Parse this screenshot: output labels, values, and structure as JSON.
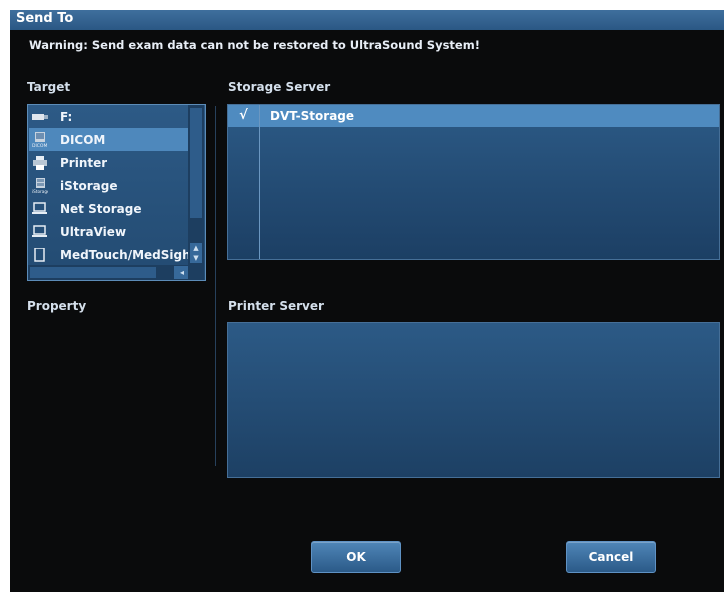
{
  "dialog": {
    "title": "Send To",
    "warning": "Warning: Send exam data can not be restored to UltraSound System!"
  },
  "target": {
    "label": "Target",
    "items": [
      {
        "label": "F:",
        "icon": "usb-drive-icon",
        "selected": false
      },
      {
        "label": "DICOM",
        "icon": "dicom-icon",
        "selected": true
      },
      {
        "label": "Printer",
        "icon": "printer-icon",
        "selected": false
      },
      {
        "label": "iStorage",
        "icon": "istorage-icon",
        "selected": false
      },
      {
        "label": "Net Storage",
        "icon": "laptop-icon",
        "selected": false
      },
      {
        "label": "UltraView",
        "icon": "laptop-icon",
        "selected": false
      },
      {
        "label": "MedTouch/MedSigh",
        "icon": "tablet-icon",
        "selected": false
      }
    ]
  },
  "property": {
    "label": "Property"
  },
  "storage_server": {
    "label": "Storage Server",
    "rows": [
      {
        "check": "√",
        "name": "DVT-Storage",
        "selected": true
      }
    ]
  },
  "printer_server": {
    "label": "Printer Server",
    "rows": []
  },
  "buttons": {
    "ok": "OK",
    "cancel": "Cancel"
  },
  "colors": {
    "selection": "#4f8bc0",
    "title_bar": "#3f6f9d",
    "panel": "#2c5a86",
    "background": "#0a0b0c"
  }
}
